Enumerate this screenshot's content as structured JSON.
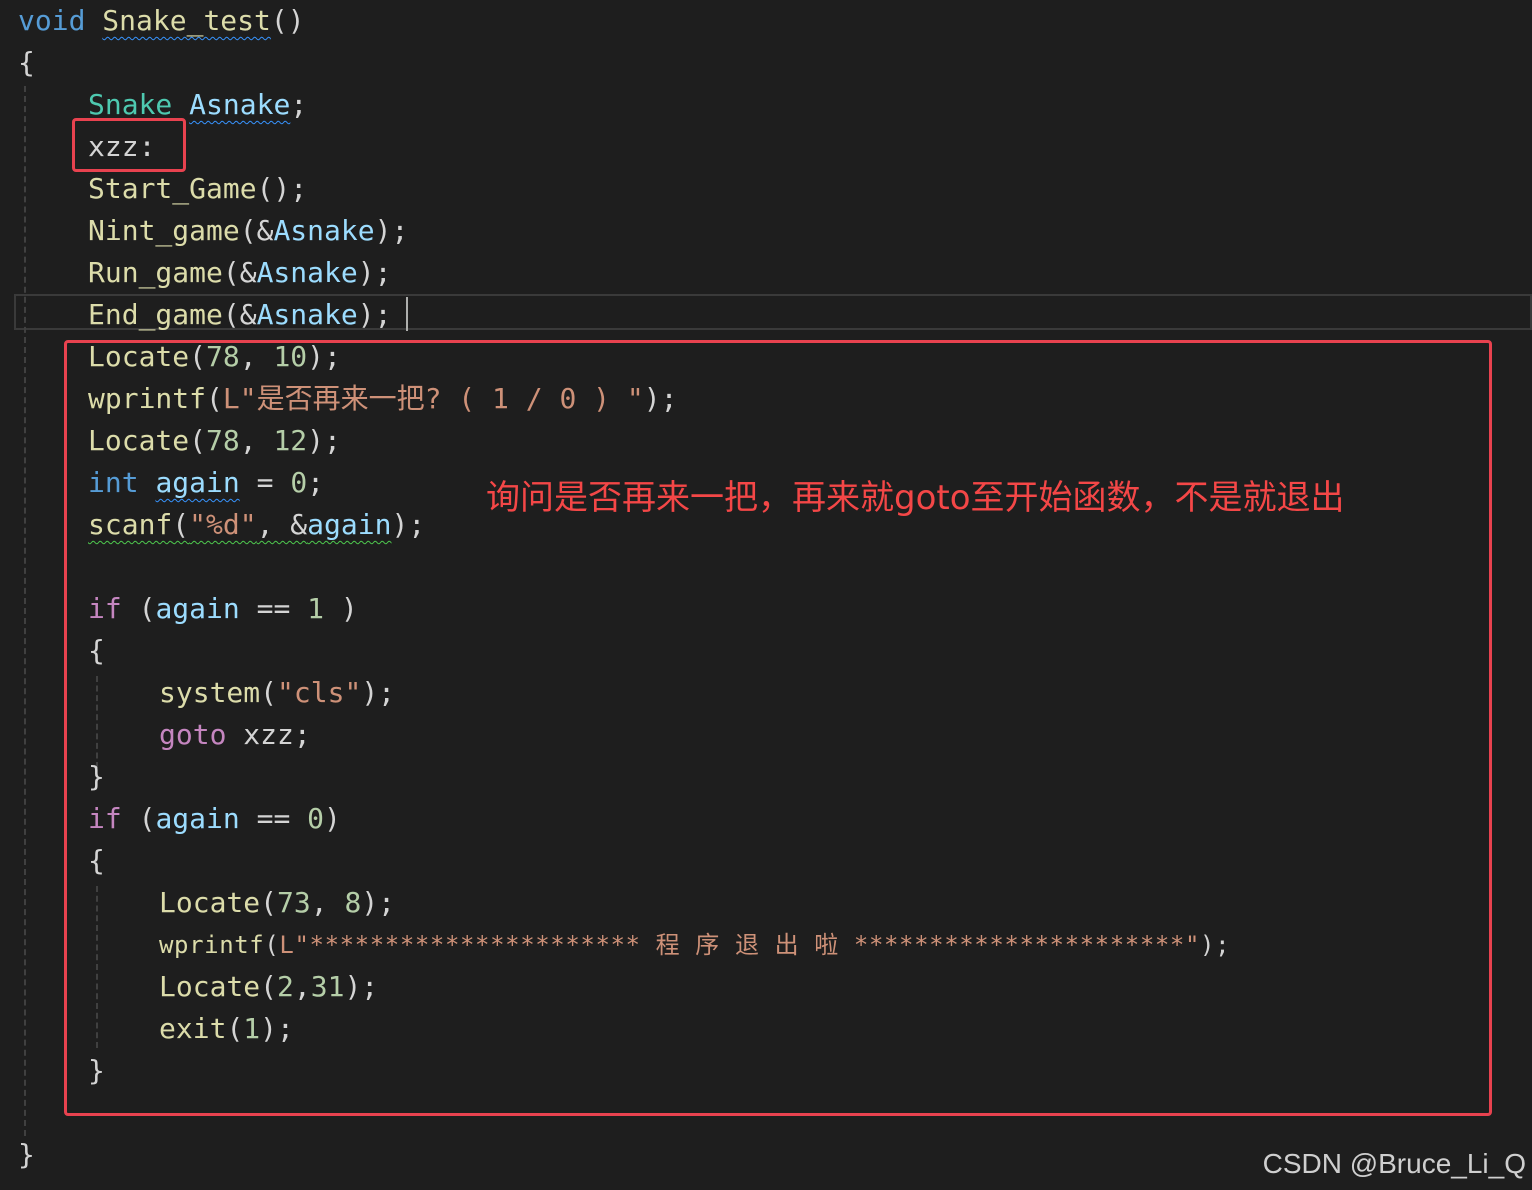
{
  "code": {
    "l1": {
      "kw": "void",
      "fn": "Snake_test",
      "rest": "()"
    },
    "l2": {
      "text": "{"
    },
    "l3": {
      "type": "Snake",
      "var": "Asnake",
      "rest": ";"
    },
    "l4": {
      "label": "xzz:"
    },
    "l5": {
      "fn": "Start_Game",
      "rest": "();"
    },
    "l6": {
      "fn": "Nint_game",
      "open": "(&",
      "var": "Asnake",
      "close": ");"
    },
    "l7": {
      "fn": "Run_game",
      "open": "(&",
      "var": "Asnake",
      "close": ");"
    },
    "l8": {
      "fn": "End_game",
      "open": "(&",
      "var": "Asnake",
      "close": ");"
    },
    "l9": {
      "fn": "Locate",
      "open": "(",
      "n1": "78",
      "sep": ", ",
      "n2": "10",
      "close": ");"
    },
    "l10": {
      "fn": "wprintf",
      "open": "(",
      "str": "L\"是否再来一把? ( 1 / 0 ) \"",
      "close": ");"
    },
    "l11": {
      "fn": "Locate",
      "open": "(",
      "n1": "78",
      "sep": ", ",
      "n2": "12",
      "close": ");"
    },
    "l12": {
      "kw": "int",
      "var": "again",
      "op": " = ",
      "num": "0",
      "close": ";"
    },
    "l13": {
      "fn": "scanf",
      "open": "(",
      "str": "\"%d\"",
      "mid": ", &",
      "var": "again",
      "close": ");"
    },
    "l14": {
      "ctl": "if",
      "open": " (",
      "var": "again",
      "op": " == ",
      "num": "1",
      "close": " )"
    },
    "l15": {
      "text": "{"
    },
    "l16": {
      "fn": "system",
      "open": "(",
      "str": "\"cls\"",
      "close": ");"
    },
    "l17": {
      "ctl": "goto",
      "rest": " xzz;"
    },
    "l18": {
      "text": "}"
    },
    "l19": {
      "ctl": "if",
      "open": " (",
      "var": "again",
      "op": " == ",
      "num": "0",
      "close": ")"
    },
    "l20": {
      "text": "{"
    },
    "l21": {
      "fn": "Locate",
      "open": "(",
      "n1": "73",
      "sep": ", ",
      "n2": "8",
      "close": ");"
    },
    "l22": {
      "fn": "wprintf",
      "open": "(",
      "str": "L\"********************** 程 序 退 出 啦 **********************\"",
      "close": ");"
    },
    "l23": {
      "fn": "Locate",
      "open": "(",
      "n1": "2",
      "sep": ",",
      "n2": "31",
      "close": ");"
    },
    "l24": {
      "fn": "exit",
      "open": "(",
      "num": "1",
      "close": ");"
    },
    "l25": {
      "text": "}"
    },
    "l26": {
      "text": "}"
    }
  },
  "annotation": "询问是否再来一把，再来就goto至开始函数，不是就退出",
  "watermark": "CSDN @Bruce_Li_Q",
  "colors": {
    "background": "#1e1e1e",
    "keyword": "#569cd6",
    "control": "#c586c0",
    "type": "#4ec9b0",
    "function": "#dcdcaa",
    "variable": "#9cdcfe",
    "number": "#b5cea8",
    "string": "#ce9178",
    "highlight_box": "#e8424f"
  }
}
